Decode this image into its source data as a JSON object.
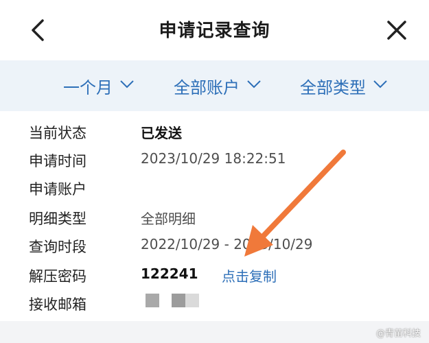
{
  "header": {
    "title": "申请记录查询",
    "back_icon": "back-arrow-icon",
    "close_icon": "close-icon"
  },
  "filters": [
    {
      "label": "一个月"
    },
    {
      "label": "全部账户"
    },
    {
      "label": "全部类型"
    }
  ],
  "details": {
    "status": {
      "label": "当前状态",
      "value": "已发送"
    },
    "apply_time": {
      "label": "申请时间",
      "value": "2023/10/29 18:22:51"
    },
    "account": {
      "label": "申请账户",
      "value": ""
    },
    "detail_type": {
      "label": "明细类型",
      "value": "全部明细"
    },
    "period": {
      "label": "查询时段",
      "value": "2022/10/29 - 2023/10/29"
    },
    "password": {
      "label": "解压密码",
      "value": "122241",
      "action": "点击复制"
    },
    "email": {
      "label": "接收邮箱",
      "value": ""
    }
  },
  "watermark": "@青苗科技",
  "colors": {
    "accent": "#2d6fb8",
    "filter_bg": "#edf3f9",
    "annotation_arrow": "#f0793a"
  }
}
